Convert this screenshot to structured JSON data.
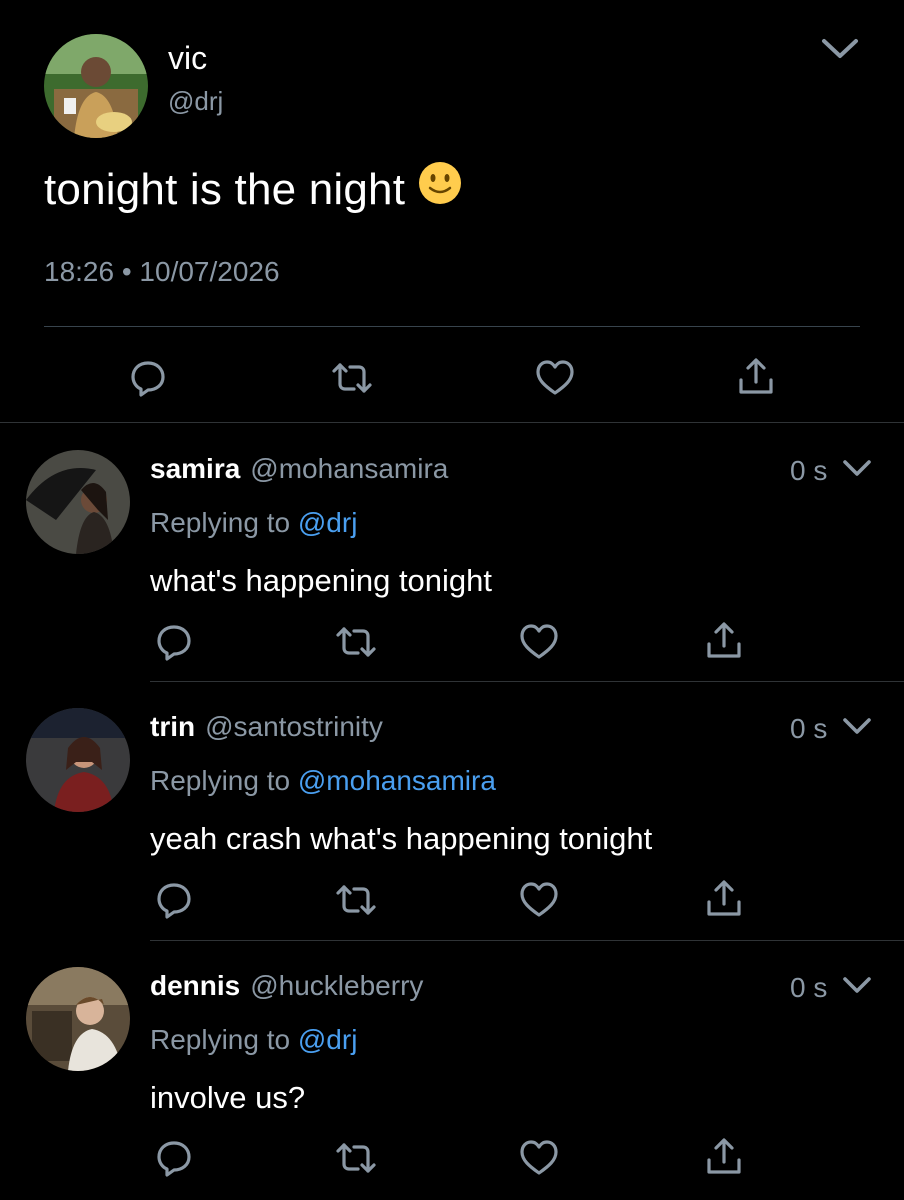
{
  "main_tweet": {
    "name": "vic",
    "handle": "@drj",
    "text": "tonight is the night",
    "emoji": "slightly-smiling-face",
    "timestamp": "18:26 • 10/07/2026",
    "actions": [
      "reply-icon",
      "retweet-icon",
      "like-icon",
      "share-icon"
    ]
  },
  "replies": [
    {
      "name": "samira",
      "handle": "@mohansamira",
      "time": "0 s",
      "replying_label": "Replying to",
      "replying_to": "@drj",
      "text": "what's happening tonight"
    },
    {
      "name": "trin",
      "handle": "@santostrinity",
      "time": "0 s",
      "replying_label": "Replying to",
      "replying_to": "@mohansamira",
      "text": "yeah crash what's happening tonight"
    },
    {
      "name": "dennis",
      "handle": "@huckleberry",
      "time": "0 s",
      "replying_label": "Replying to",
      "replying_to": "@drj",
      "text": "involve us?"
    }
  ],
  "colors": {
    "background": "#000000",
    "text": "#ffffff",
    "secondary": "#8b98a5",
    "link": "#4a9ff0",
    "divider": "#2f3336"
  }
}
